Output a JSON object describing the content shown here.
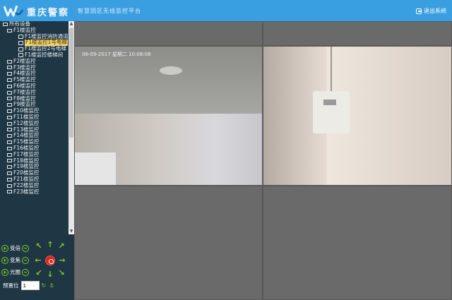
{
  "header": {
    "brand": "重庆警察",
    "subtitle": "智慧园区无线监控平台",
    "logout_label": "退出系统"
  },
  "tree": {
    "root": "所有设备",
    "floor1": "F1楼监控",
    "cameras": [
      "F1楼监控消防通道",
      "F1楼监控1号电梯",
      "F1楼监控2号电梯",
      "F1楼监控楼梯间"
    ],
    "floors": [
      "F2楼监控",
      "F3楼监控",
      "F4楼监控",
      "F5楼监控",
      "F6楼监控",
      "F7楼监控",
      "F8楼监控",
      "F9楼监控",
      "F10楼监控",
      "F11楼监控",
      "F12楼监控",
      "F13楼监控",
      "F14楼监控",
      "F15楼监控",
      "F16楼监控",
      "F17楼监控",
      "F18楼监控",
      "F19楼监控",
      "F20楼监控",
      "F21楼监控",
      "F22楼监控",
      "F23楼监控"
    ]
  },
  "ptz": {
    "zoom_label": "变倍",
    "focus_label": "变焦",
    "iris_label": "光圈",
    "preset_label": "预置位",
    "preset_value": "1"
  },
  "video": {
    "osd1": "06-09-2017 星期二 10:08:08"
  },
  "colors": {
    "header_bg": "#3a9fe0",
    "sidebar_bg": "#1f3644",
    "ptz_green": "#7dd321",
    "stop_red": "#d8241b",
    "selected_bg": "#f6d56b"
  }
}
